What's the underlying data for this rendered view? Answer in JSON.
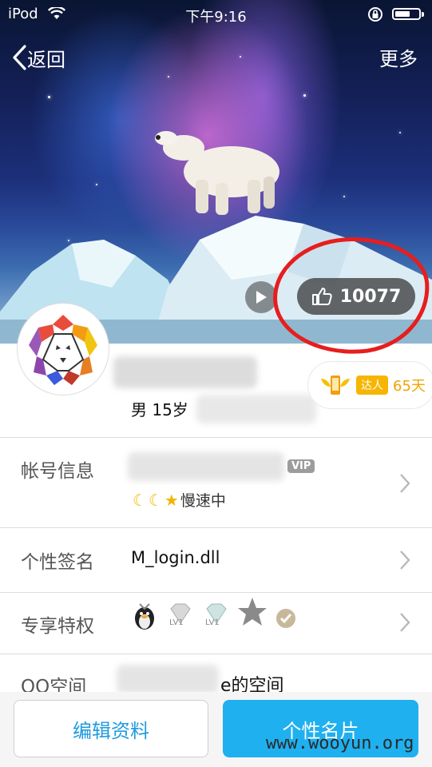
{
  "status_bar": {
    "carrier": "iPod",
    "time": "下午9:16",
    "battery_level": 0.7
  },
  "nav": {
    "back_label": "返回",
    "more_label": "更多"
  },
  "cover": {
    "like_count": "10077"
  },
  "profile": {
    "gender_age": "男 15岁",
    "daren_tag": "达人",
    "daren_days": "65天"
  },
  "rows": {
    "account": {
      "label": "帐号信息",
      "vip": "VIP",
      "speed": "慢速中"
    },
    "signature": {
      "label": "个性签名",
      "value": "M_login.dll"
    },
    "privileges": {
      "label": "专享特权",
      "lv1": "LV1",
      "lv2": "LV1"
    },
    "qzone": {
      "label": "QQ空间",
      "value_suffix": "e的空间"
    }
  },
  "bottom": {
    "edit_label": "编辑资料",
    "card_label": "个性名片"
  },
  "watermark": "www.wooyun.org"
}
